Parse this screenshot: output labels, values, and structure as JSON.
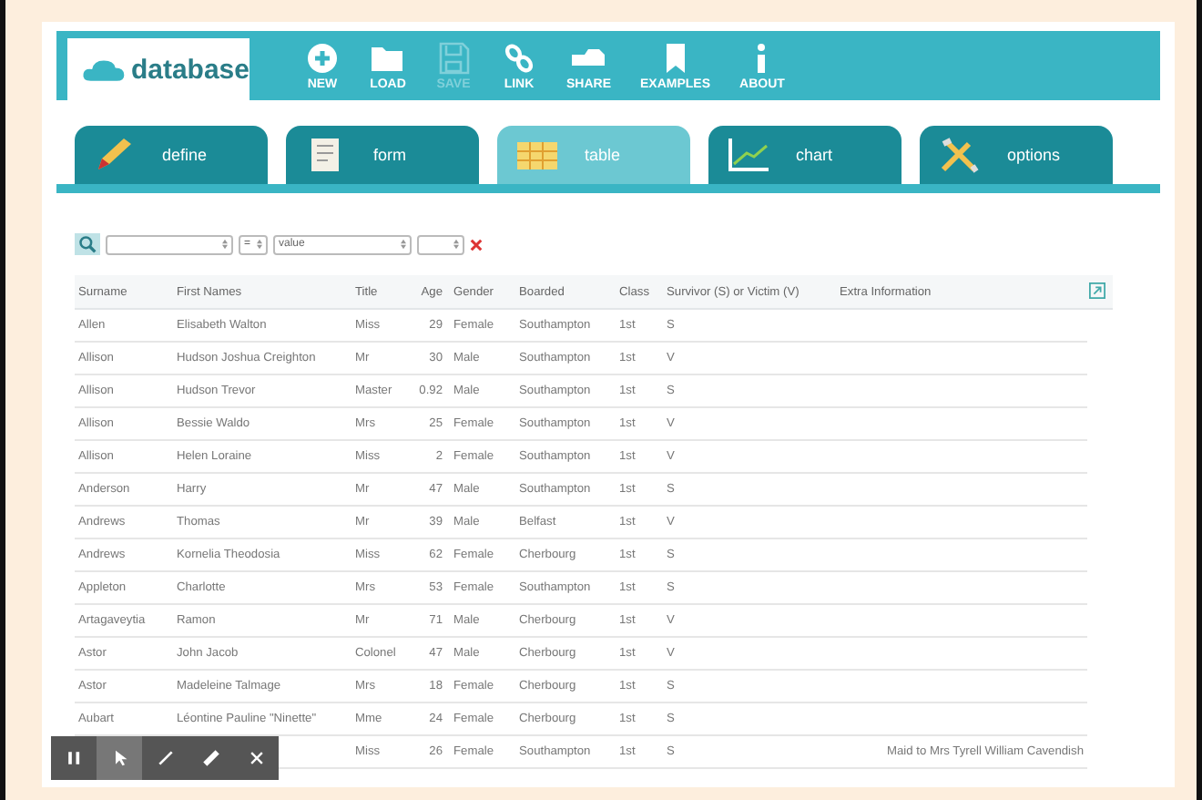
{
  "logo": "database",
  "toolbar": [
    {
      "label": "NEW",
      "disabled": false
    },
    {
      "label": "LOAD",
      "disabled": false
    },
    {
      "label": "SAVE",
      "disabled": true
    },
    {
      "label": "LINK",
      "disabled": false
    },
    {
      "label": "SHARE",
      "disabled": false
    },
    {
      "label": "EXAMPLES",
      "disabled": false
    },
    {
      "label": "ABOUT",
      "disabled": false
    }
  ],
  "tabs": [
    {
      "label": "define",
      "selected": false
    },
    {
      "label": "form",
      "selected": false
    },
    {
      "label": "table",
      "selected": true
    },
    {
      "label": "chart",
      "selected": false
    },
    {
      "label": "options",
      "selected": false
    }
  ],
  "filter": {
    "operator": "=",
    "value": "value"
  },
  "table": {
    "columns": [
      "Surname",
      "First Names",
      "Title",
      "Age",
      "Gender",
      "Boarded",
      "Class",
      "Survivor (S) or Victim (V)",
      "Extra Information"
    ],
    "rows": [
      [
        "Allen",
        "Elisabeth Walton",
        "Miss",
        "29",
        "Female",
        "Southampton",
        "1st",
        "S",
        null
      ],
      [
        "Allison",
        "Hudson Joshua Creighton",
        "Mr",
        "30",
        "Male",
        "Southampton",
        "1st",
        "V",
        null
      ],
      [
        "Allison",
        "Hudson Trevor",
        "Master",
        "0.92",
        "Male",
        "Southampton",
        "1st",
        "S",
        null
      ],
      [
        "Allison",
        "Bessie Waldo",
        "Mrs",
        "25",
        "Female",
        "Southampton",
        "1st",
        "V",
        null
      ],
      [
        "Allison",
        "Helen Loraine",
        "Miss",
        "2",
        "Female",
        "Southampton",
        "1st",
        "V",
        null
      ],
      [
        "Anderson",
        "Harry",
        "Mr",
        "47",
        "Male",
        "Southampton",
        "1st",
        "S",
        null
      ],
      [
        "Andrews",
        "Thomas",
        "Mr",
        "39",
        "Male",
        "Belfast",
        "1st",
        "V",
        null
      ],
      [
        "Andrews",
        "Kornelia Theodosia",
        "Miss",
        "62",
        "Female",
        "Cherbourg",
        "1st",
        "S",
        null
      ],
      [
        "Appleton",
        "Charlotte",
        "Mrs",
        "53",
        "Female",
        "Southampton",
        "1st",
        "S",
        null
      ],
      [
        "Artagaveytia",
        "Ramon",
        "Mr",
        "71",
        "Male",
        "Cherbourg",
        "1st",
        "V",
        null
      ],
      [
        "Astor",
        "John Jacob",
        "Colonel",
        "47",
        "Male",
        "Cherbourg",
        "1st",
        "V",
        null
      ],
      [
        "Astor",
        "Madeleine Talmage",
        "Mrs",
        "18",
        "Female",
        "Cherbourg",
        "1st",
        "S",
        null
      ],
      [
        "Aubart",
        "Léontine Pauline \"Ninette\"",
        "Mme",
        "24",
        "Female",
        "Cherbourg",
        "1st",
        "S",
        null
      ],
      [
        null,
        null,
        "Miss",
        "26",
        "Female",
        "Southampton",
        "1st",
        "S",
        "Maid to Mrs Tyrell William Cavendish"
      ]
    ]
  },
  "annotation_tools": [
    {
      "kind": "pause",
      "selected": false
    },
    {
      "kind": "pointer",
      "selected": true
    },
    {
      "kind": "pen",
      "selected": false
    },
    {
      "kind": "marker",
      "selected": false
    },
    {
      "kind": "close",
      "selected": false
    }
  ]
}
